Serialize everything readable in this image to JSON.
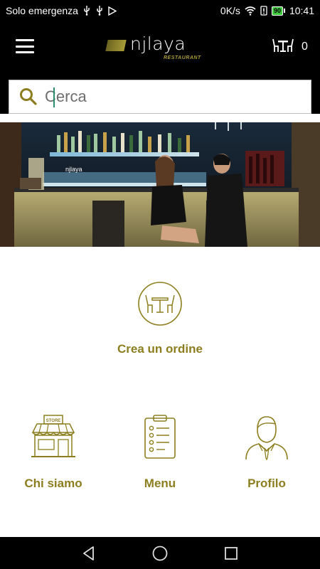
{
  "status_bar": {
    "carrier": "Solo emergenza",
    "speed": "0K/s",
    "battery": "90",
    "time": "10:41"
  },
  "app_bar": {
    "logo_text": "njlaya",
    "logo_sub": "RESTAURANT",
    "cart_count": "0"
  },
  "search": {
    "placeholder": "Cerca",
    "value": ""
  },
  "actions": {
    "order_label": "Crea un ordine",
    "about_label": "Chi siamo",
    "menu_label": "Menu",
    "profile_label": "Profilo",
    "store_sign": "STORE"
  },
  "hero": {
    "sign_text": "njlaya"
  },
  "colors": {
    "accent": "#8c7e1e",
    "bar_bg": "#000000",
    "battery": "#3ec93e"
  },
  "icons": [
    "menu-icon",
    "search-icon",
    "table-chairs-icon",
    "store-icon",
    "clipboard-icon",
    "user-icon",
    "back-icon",
    "home-icon",
    "recents-icon"
  ]
}
